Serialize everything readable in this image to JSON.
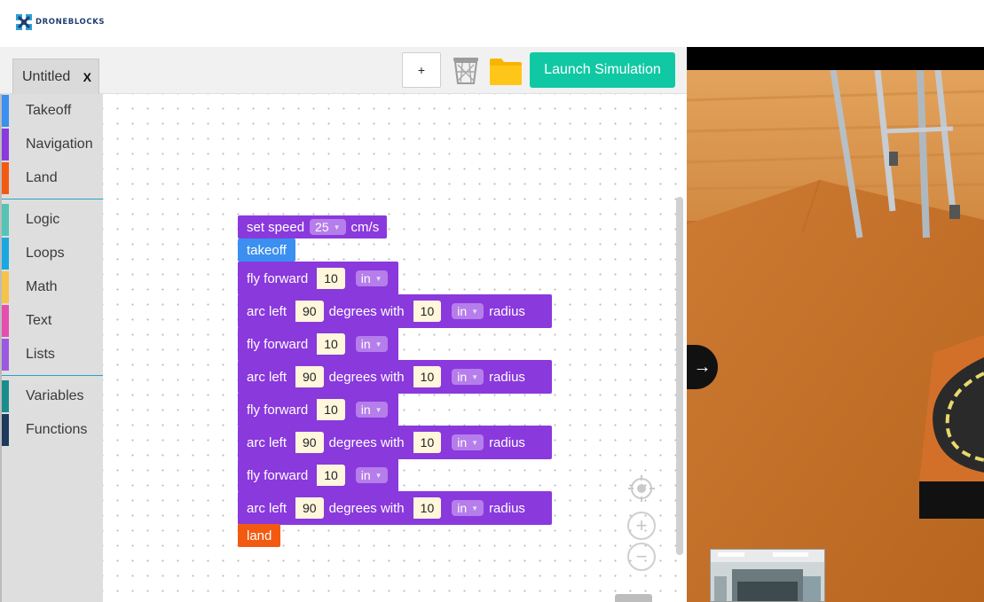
{
  "app": {
    "brand": "DRONEBLOCKS",
    "brand_color": "#1f3f6e",
    "accent": "#10c9a4"
  },
  "file_tab": {
    "title": "Untitled",
    "close": "X"
  },
  "toolbar": {
    "add_label": "+",
    "trash_icon": "trash-icon",
    "folder_icon": "folder-icon",
    "launch_label": "Launch Simulation"
  },
  "sidebar": {
    "groups": [
      [
        {
          "label": "Takeoff",
          "color": "#3b8ff0"
        },
        {
          "label": "Navigation",
          "color": "#8a39dd"
        },
        {
          "label": "Land",
          "color": "#f25a12"
        }
      ],
      [
        {
          "label": "Logic",
          "color": "#55c3b5"
        },
        {
          "label": "Loops",
          "color": "#1aa8e0"
        },
        {
          "label": "Math",
          "color": "#f6c34a"
        },
        {
          "label": "Text",
          "color": "#e64db0"
        },
        {
          "label": "Lists",
          "color": "#9a5ae0"
        }
      ],
      [
        {
          "label": "Variables",
          "color": "#1a8c8c"
        },
        {
          "label": "Functions",
          "color": "#1d3a5c"
        }
      ]
    ]
  },
  "blocks": {
    "set_speed": {
      "label": "set speed",
      "value": "25",
      "unit": "cm/s"
    },
    "takeoff": {
      "label": "takeoff"
    },
    "land": {
      "label": "land"
    },
    "sequence": [
      {
        "type": "fly",
        "label": "fly forward",
        "value": "10",
        "unit": "in"
      },
      {
        "type": "arc",
        "label": "arc left",
        "degrees": "90",
        "mid": "degrees with",
        "radius_value": "10",
        "unit": "in",
        "end": "radius"
      },
      {
        "type": "fly",
        "label": "fly forward",
        "value": "10",
        "unit": "in"
      },
      {
        "type": "arc",
        "label": "arc left",
        "degrees": "90",
        "mid": "degrees with",
        "radius_value": "10",
        "unit": "in",
        "end": "radius"
      },
      {
        "type": "fly",
        "label": "fly forward",
        "value": "10",
        "unit": "in"
      },
      {
        "type": "arc",
        "label": "arc left",
        "degrees": "90",
        "mid": "degrees with",
        "radius_value": "10",
        "unit": "in",
        "end": "radius"
      },
      {
        "type": "fly",
        "label": "fly forward",
        "value": "10",
        "unit": "in"
      },
      {
        "type": "arc",
        "label": "arc left",
        "degrees": "90",
        "mid": "degrees with",
        "radius_value": "10",
        "unit": "in",
        "end": "radius"
      }
    ]
  },
  "zoom": {
    "recenter_icon": "crosshair-icon",
    "zoom_in": "+",
    "zoom_out": "−"
  },
  "simulator": {
    "toggle_label": "→"
  }
}
